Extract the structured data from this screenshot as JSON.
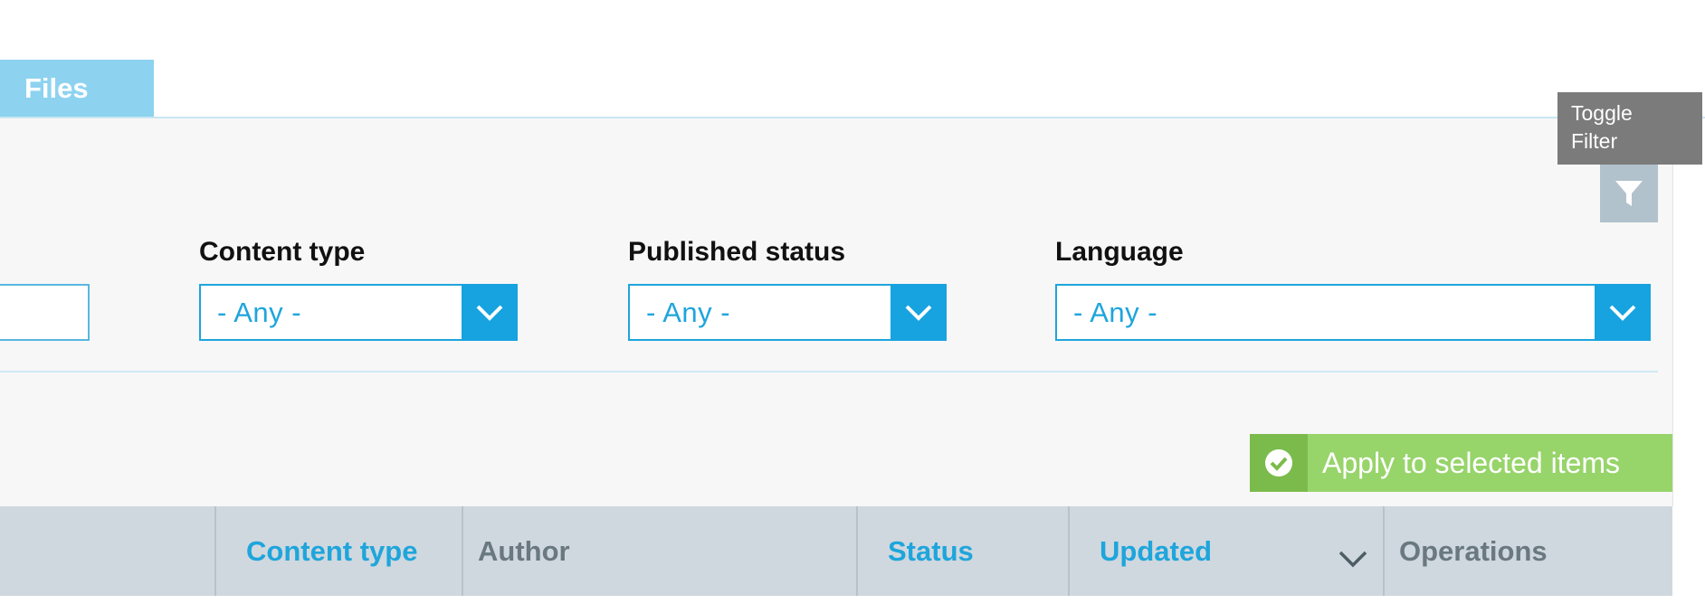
{
  "tabs": {
    "files_label": "Files"
  },
  "tooltip": {
    "line1": "Toggle",
    "line2": "Filter"
  },
  "filters": {
    "content_type": {
      "label": "Content type",
      "value": "- Any -"
    },
    "published_status": {
      "label": "Published status",
      "value": "- Any -"
    },
    "language": {
      "label": "Language",
      "value": "- Any -"
    }
  },
  "bulk_action": {
    "apply_label": "Apply to selected items"
  },
  "table": {
    "headers": {
      "content_type": "Content type",
      "author": "Author",
      "status": "Status",
      "updated": "Updated",
      "operations": "Operations"
    }
  },
  "colors": {
    "accent_blue": "#1ea5dc",
    "tab_blue": "#8dd3f0",
    "apply_green": "#97d46a",
    "header_gray": "#cfd8de"
  },
  "icons": {
    "filter": "filter-funnel-icon",
    "dropdown": "chevron-down-icon",
    "check": "check-circle-icon",
    "sort": "sort-descending-icon"
  }
}
